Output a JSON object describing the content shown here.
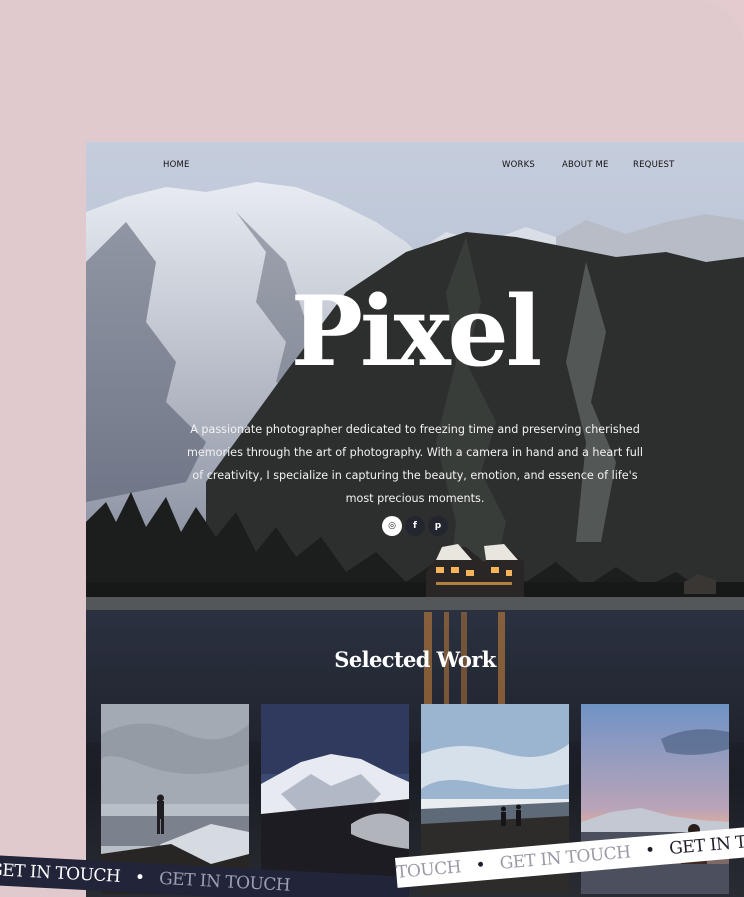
{
  "nav": {
    "home": "HOME",
    "works": "WORKS",
    "about": "ABOUT ME",
    "request": "REQUEST"
  },
  "hero": {
    "title": "Pixel",
    "description": "A passionate photographer dedicated to freezing time and preserving cherished memories through the art of photography. With a camera in hand and a heart full of creativity, I specialize in capturing the beauty, emotion, and essence of life's most precious moments."
  },
  "socials": [
    {
      "name": "instagram-icon",
      "glyph": "◎"
    },
    {
      "name": "facebook-icon",
      "glyph": "f"
    },
    {
      "name": "pinterest-icon",
      "glyph": "p"
    }
  ],
  "selected_work": {
    "title": "Selected Work"
  },
  "ribbons": {
    "left": [
      "GET IN TOUCH",
      "•",
      "GET IN TOUCH"
    ],
    "right": [
      "TOUCH",
      "•",
      "GET IN TOUCH",
      "•",
      "GET IN T"
    ]
  },
  "colors": {
    "page_bg": "#e1cace",
    "dark_ribbon": "#22243a"
  }
}
